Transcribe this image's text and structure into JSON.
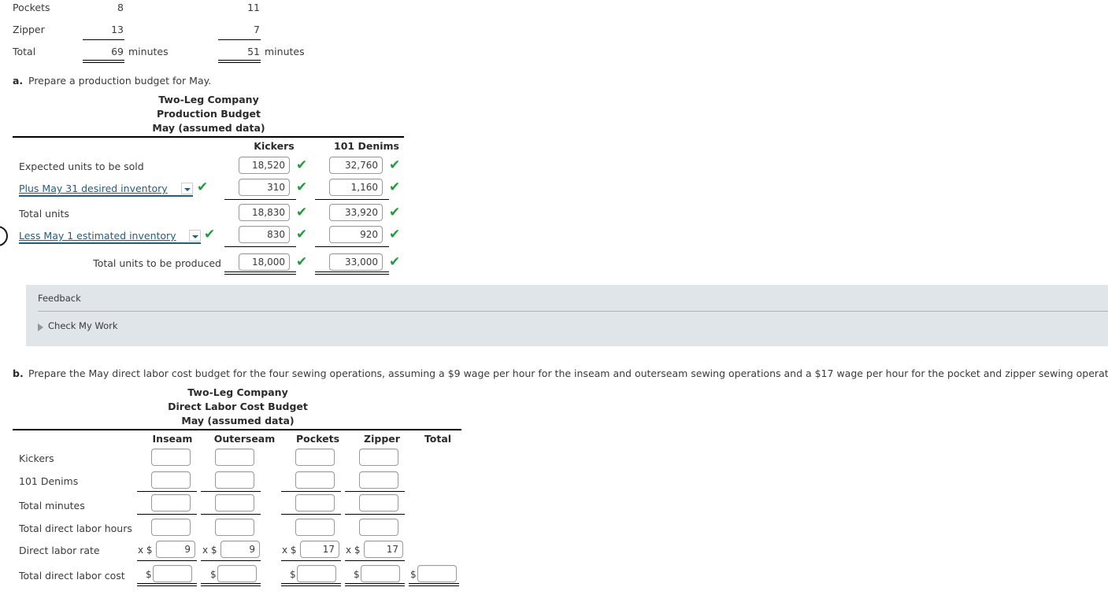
{
  "top_table": {
    "rows": [
      {
        "label": "Pockets",
        "col1": "8",
        "col2": "11",
        "unit1": "",
        "unit2": ""
      },
      {
        "label": "Zipper",
        "col1": "13",
        "col2": "7",
        "unit1": "",
        "unit2": ""
      },
      {
        "label": "Total",
        "col1": "69",
        "col2": "51",
        "unit1": "minutes",
        "unit2": "minutes"
      }
    ]
  },
  "part_a": {
    "letter": "a.",
    "instruction": "Prepare a production budget for May.",
    "title_line1": "Two-Leg Company",
    "title_line2": "Production Budget",
    "title_line3": "May (assumed data)",
    "columns": [
      "Kickers",
      "101 Denims"
    ],
    "rows": [
      {
        "label": "Expected units to be sold",
        "type": "text",
        "kickers": "18,520",
        "denims": "32,760",
        "kickers_correct": "✔",
        "denims_correct": "✔"
      },
      {
        "label": "Plus May 31 desired inventory",
        "type": "select",
        "select_correct": "✔",
        "kickers": "310",
        "denims": "1,160",
        "kickers_correct": "✔",
        "denims_correct": "✔"
      },
      {
        "label": "Total units",
        "type": "text",
        "kickers": "18,830",
        "denims": "33,920",
        "kickers_correct": "✔",
        "denims_correct": "✔"
      },
      {
        "label": "Less May 1 estimated inventory",
        "type": "select",
        "select_correct": "✔",
        "kickers": "830",
        "denims": "920",
        "kickers_correct": "✔",
        "denims_correct": "✔"
      },
      {
        "label": "Total units to be produced",
        "type": "text-right",
        "kickers": "18,000",
        "denims": "33,000",
        "kickers_correct": "✔",
        "denims_correct": "✔"
      }
    ]
  },
  "feedback": {
    "title": "Feedback",
    "check_my_work": "Check My Work"
  },
  "part_b": {
    "letter": "b.",
    "instruction": "Prepare the May direct labor cost budget for the four sewing operations, assuming a $9 wage per hour for the inseam and outerseam sewing operations and a $17 wage per hour for the pocket and zipper sewing operations.",
    "title_line1": "Two-Leg Company",
    "title_line2": "Direct Labor Cost Budget",
    "title_line3": "May (assumed data)",
    "columns": [
      "Inseam",
      "Outerseam",
      "Pockets",
      "Zipper",
      "Total"
    ],
    "rows": [
      {
        "label": "Kickers",
        "values": [
          "",
          "",
          "",
          ""
        ],
        "prefix": ""
      },
      {
        "label": "101 Denims",
        "values": [
          "",
          "",
          "",
          ""
        ],
        "prefix": ""
      },
      {
        "label": "Total minutes",
        "values": [
          "",
          "",
          "",
          ""
        ],
        "prefix": ""
      },
      {
        "label": "Total direct labor hours",
        "values": [
          "",
          "",
          "",
          ""
        ],
        "prefix": ""
      },
      {
        "label": "Direct labor rate",
        "values": [
          "9",
          "9",
          "17",
          "17"
        ],
        "prefix": "x $"
      },
      {
        "label": "Total direct labor cost",
        "values": [
          "",
          "",
          "",
          "",
          ""
        ],
        "prefix": "$"
      }
    ]
  }
}
